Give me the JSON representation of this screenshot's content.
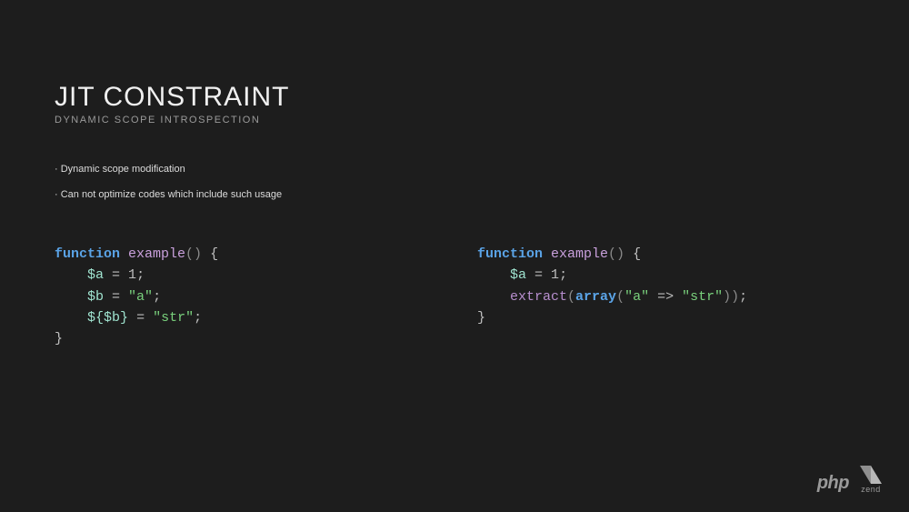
{
  "title": "JIT CONSTRAINT",
  "subtitle": "DYNAMIC SCOPE INTROSPECTION",
  "bullets": [
    "Dynamic scope modification",
    "Can not optimize codes which include such usage"
  ],
  "code_left": {
    "kw_function": "function",
    "fn_name": "example",
    "parens": "()",
    "brace_open": "{",
    "var_a": "$a",
    "eq": " = ",
    "num1": "1",
    "semi": ";",
    "var_b": "$b",
    "str_a": "\"a\"",
    "var_deref_open": "${",
    "var_deref_inner": "$b",
    "var_deref_close": "}",
    "str_str": "\"str\"",
    "brace_close": "}"
  },
  "code_right": {
    "kw_function": "function",
    "fn_name": "example",
    "parens": "()",
    "brace_open": "{",
    "var_a": "$a",
    "eq": " = ",
    "num1": "1",
    "semi": ";",
    "extract": "extract",
    "lp": "(",
    "kw_array": "array",
    "lp2": "(",
    "str_a": "\"a\"",
    "arrow": " => ",
    "str_str": "\"str\"",
    "rp2": ")",
    "rp": ")",
    "brace_close": "}"
  },
  "footer": {
    "php": "php",
    "zend": "zend"
  }
}
